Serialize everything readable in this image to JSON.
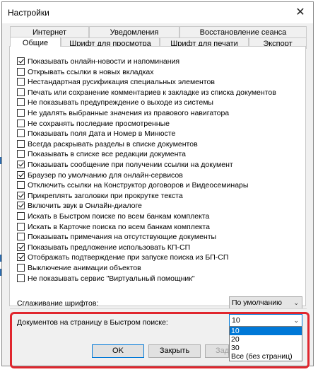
{
  "window": {
    "title": "Настройки",
    "close_glyph": "✕"
  },
  "tabs_back": [
    "Интернет",
    "Уведомления",
    "Восстановление сеанса"
  ],
  "tabs_front": [
    "Общие",
    "Шрифт для просмотра",
    "Шрифт для печати",
    "Экспорт"
  ],
  "active_tab": "Общие",
  "options": [
    {
      "label": "Показывать онлайн-новости и напоминания",
      "checked": true
    },
    {
      "label": "Открывать ссылки в новых вкладках",
      "checked": false
    },
    {
      "label": "Нестандартная русификация специальных элементов",
      "checked": false
    },
    {
      "label": "Печать или сохранение комментариев к закладке из списка документов",
      "checked": false
    },
    {
      "label": "Не показывать предупреждение о выходе из системы",
      "checked": false
    },
    {
      "label": "Не удалять выбранные значения из правового навигатора",
      "checked": false
    },
    {
      "label": "Не сохранять последние просмотренные",
      "checked": false
    },
    {
      "label": "Показывать поля Дата и Номер в Минюсте",
      "checked": false
    },
    {
      "label": "Всегда раскрывать разделы в списке документов",
      "checked": false
    },
    {
      "label": "Показывать в списке все редакции документа",
      "checked": false
    },
    {
      "label": "Показывать сообщение при получении ссылки на документ",
      "checked": true
    },
    {
      "label": "Браузер по умолчанию для онлайн-сервисов",
      "checked": true
    },
    {
      "label": "Отключить ссылки на Конструктор договоров и Видеосеминары",
      "checked": false
    },
    {
      "label": "Прикреплять заголовки при прокрутке текста",
      "checked": true
    },
    {
      "label": "Включить звук в Онлайн-диалоге",
      "checked": true
    },
    {
      "label": "Искать в Быстром поиске по всем банкам комплекта",
      "checked": false
    },
    {
      "label": "Искать в Карточке поиска по всем банкам комплекта",
      "checked": false
    },
    {
      "label": "Показывать примечания на отсутствующие документы",
      "checked": false
    },
    {
      "label": "Показывать предложение использовать КП-СП",
      "checked": true
    },
    {
      "label": "Отображать подтверждение при запуске поиска из БП-СП",
      "checked": true
    },
    {
      "label": "Выключение анимации объектов",
      "checked": false
    },
    {
      "label": "Не показывать сервис \"Виртуальный помощник\"",
      "checked": false
    }
  ],
  "font_smoothing": {
    "label": "Сглаживание шрифтов:",
    "value": "По умолчанию"
  },
  "docs_per_page": {
    "label": "Документов на страницу в Быстром поиске:",
    "value": "10",
    "options": [
      "10",
      "20",
      "30",
      "Все (без страниц)"
    ],
    "selected": "10"
  },
  "buttons": {
    "ok": "OK",
    "close": "Закрыть",
    "partial": "Зад"
  },
  "accent_color": "#0078d7",
  "highlight_color": "#e0262e"
}
